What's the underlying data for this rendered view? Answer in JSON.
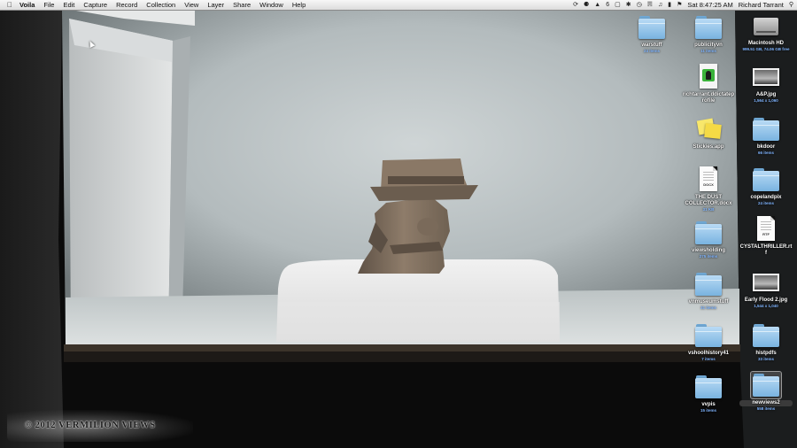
{
  "menubar": {
    "apple": "",
    "app_name": "Voila",
    "menus": [
      "File",
      "Edit",
      "Capture",
      "Record",
      "Collection",
      "View",
      "Layer",
      "Share",
      "Window",
      "Help"
    ],
    "status_badge": "6",
    "clock": "Sat 8:47:25 AM",
    "user": "Richard Tarrant"
  },
  "desktop_icons": [
    {
      "name": "warstuff",
      "sub": "24 items",
      "type": "folder"
    },
    {
      "name": "publicityvn",
      "sub": "11 items",
      "type": "folder"
    },
    {
      "name": "Macintosh HD",
      "sub": "999.51 GB, 74.06 GB free",
      "type": "drive"
    },
    {
      "name": "richtarrant.ddictateprofile",
      "sub": "",
      "type": "profile"
    },
    {
      "name": "A&P.jpg",
      "sub": "1,564 x 1,060",
      "type": "photo"
    },
    {
      "name": "Stickies.app",
      "sub": "",
      "type": "stickies"
    },
    {
      "name": "bkdoor",
      "sub": "66 items",
      "type": "folder"
    },
    {
      "name": "THE DUST COLLECTOR.docx",
      "sub": "31 KB",
      "type": "doc",
      "tag": "DOCX"
    },
    {
      "name": "copelandpix",
      "sub": "24 items",
      "type": "folder"
    },
    {
      "name": "viewsholding",
      "sub": "275 items",
      "type": "folder"
    },
    {
      "name": "CYSTALTHRILLER.rtf",
      "sub": "",
      "type": "doc",
      "tag": "RTF"
    },
    {
      "name": "vnmuseumstuff",
      "sub": "31 items",
      "type": "folder"
    },
    {
      "name": "Early Flood 2.jpg",
      "sub": "1,544 x 1,040",
      "type": "photo"
    },
    {
      "name": "vshoolhistory41",
      "sub": "7 items",
      "type": "folder"
    },
    {
      "name": "histpdfs",
      "sub": "33 items",
      "type": "folder"
    },
    {
      "name": "vvpis",
      "sub": "15 items",
      "type": "folder"
    },
    {
      "name": "newviews2",
      "sub": "558 items",
      "type": "folder",
      "selected": true
    }
  ],
  "watermark": "© 2012 VERMILION VIEWS",
  "colors": {
    "folder_blue": "#8cc2ec",
    "backdrop_grey": "#c7cdcf",
    "statuette_clay": "#8a7866"
  }
}
